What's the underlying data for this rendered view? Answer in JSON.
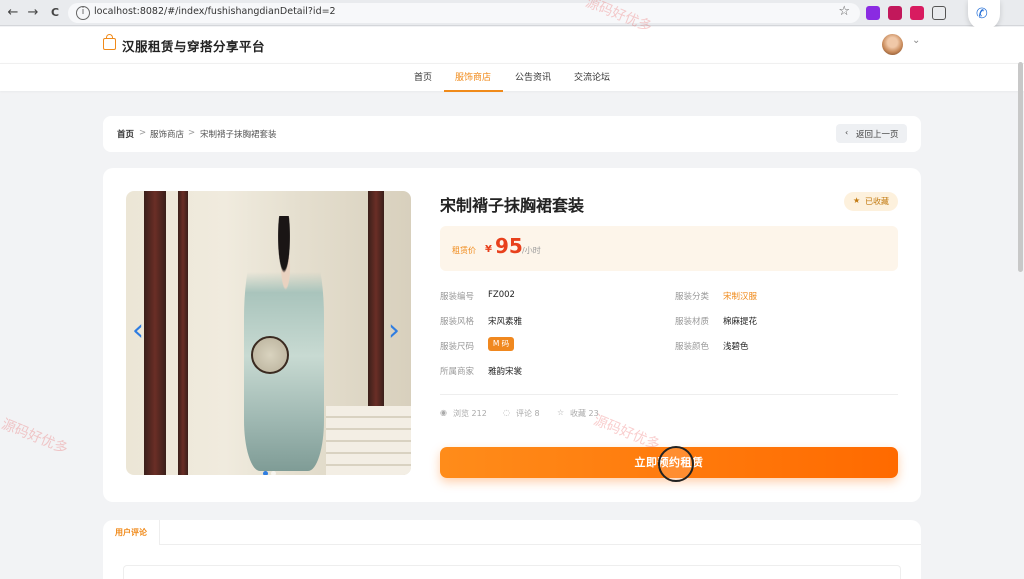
{
  "browser": {
    "url": "localhost:8082/#/index/fushishangdianDetail?id=2",
    "back": "←",
    "forward": "→",
    "reload": "C",
    "info": "i",
    "star": "☆",
    "call_icon": "✆"
  },
  "header": {
    "site_title": "汉服租赁与穿搭分享平台",
    "avatar_chevron": "⌄"
  },
  "nav": {
    "items": [
      {
        "label": "首页"
      },
      {
        "label": "服饰商店"
      },
      {
        "label": "公告资讯"
      },
      {
        "label": "交流论坛"
      }
    ],
    "active": "服饰商店"
  },
  "breadcrumb": {
    "home": "首页",
    "sep": ">",
    "section": "服饰商店",
    "current": "宋制褙子抹胸裙套装",
    "back_icon": "‹",
    "back_label": "返回上一页"
  },
  "carousel": {
    "prev": "‹",
    "next": "›",
    "slide_count": 2,
    "active_slide": 1
  },
  "product": {
    "title": "宋制褙子抹胸裙套装",
    "fav_icon": "★",
    "fav_label": "已收藏",
    "price_label": "租赁价",
    "currency": "¥",
    "price": "95",
    "unit": "/小时",
    "details": [
      {
        "label": "服装编号",
        "value": "FZ002"
      },
      {
        "label": "服装分类",
        "value": "宋制汉服"
      },
      {
        "label": "服装风格",
        "value": "宋风素雅"
      },
      {
        "label": "服装材质",
        "value": "棉麻提花"
      },
      {
        "label": "服装尺码",
        "value": "M 码"
      },
      {
        "label": "服装颜色",
        "value": "浅碧色"
      },
      {
        "label": "所属商家",
        "value": "雅韵宋裳"
      }
    ],
    "stats": {
      "views": "浏览 212",
      "comments": "评论 8",
      "favorites": "收藏 23",
      "views_icon": "◉",
      "comments_icon": "◌",
      "favorites_icon": "☆"
    },
    "rent_button": "立即预约租赁"
  },
  "reviews": {
    "tab_label": "用户评论"
  },
  "watermark": {
    "text": "源码好优多"
  },
  "colors": {
    "accent": "#f08a1a",
    "price": "#e8401c",
    "carousel_arrow": "#2f7de1"
  }
}
